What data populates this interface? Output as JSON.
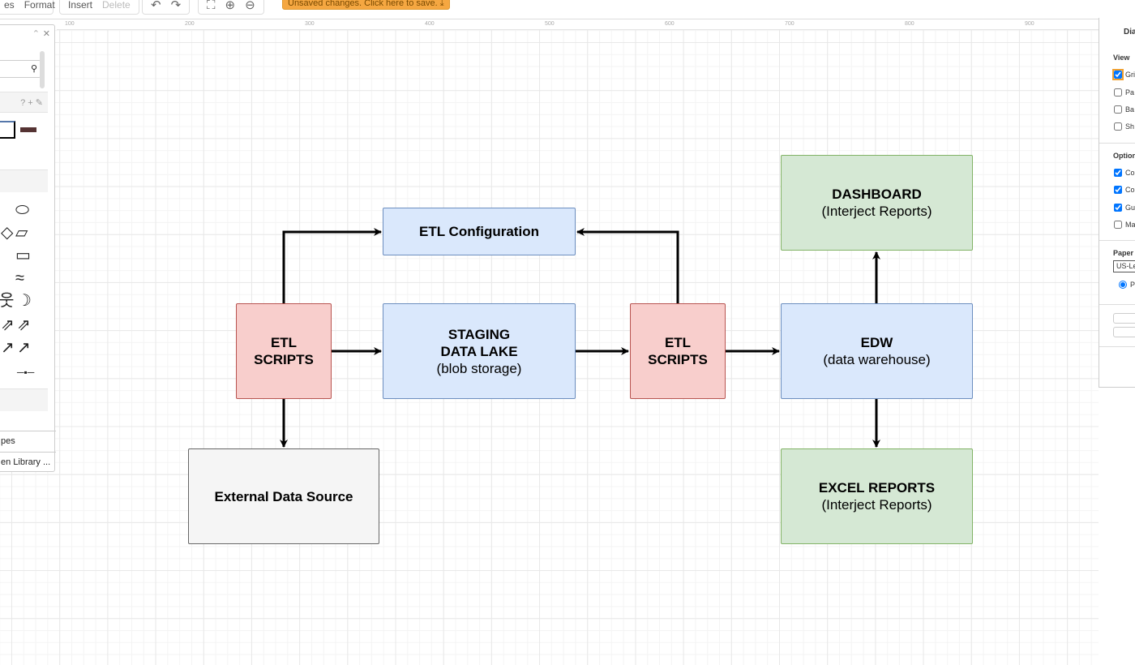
{
  "toolbar": {
    "tab_shapes": "es",
    "tab_format": "Format",
    "insert": "Insert",
    "delete": "Delete",
    "unsaved": "Unsaved changes. Click here to save."
  },
  "ruler": [
    "100",
    "200",
    "300",
    "400",
    "500",
    "600",
    "700",
    "800",
    "900"
  ],
  "left_panel": {
    "more_shapes": "pes",
    "open_library": "en Library ..."
  },
  "right_panel": {
    "title": "Dia",
    "view": "View",
    "view_items": [
      {
        "label": "Gri",
        "checked": true
      },
      {
        "label": "Pa",
        "checked": false
      },
      {
        "label": "Ba",
        "checked": false
      },
      {
        "label": "Sh",
        "checked": false
      }
    ],
    "options": "Option",
    "option_items": [
      {
        "label": "Co",
        "checked": true
      },
      {
        "label": "Co",
        "checked": true
      },
      {
        "label": "Gu",
        "checked": true
      },
      {
        "label": "Ma",
        "checked": false
      }
    ],
    "paper": "Paper",
    "paper_value": "US-Le",
    "orientation": "P"
  },
  "diagram": {
    "etl_config": "ETL Configuration",
    "etl_left": [
      "ETL",
      "SCRIPTS"
    ],
    "staging": [
      "STAGING",
      "DATA LAKE",
      "(blob storage)"
    ],
    "etl_right": [
      "ETL",
      "SCRIPTS"
    ],
    "edw": [
      "EDW",
      "(data warehouse)"
    ],
    "dashboard": [
      "DASHBOARD",
      "(Interject Reports)"
    ],
    "excel": [
      "EXCEL REPORTS",
      "(Interject Reports)"
    ],
    "external": "External Data Source",
    "colors": {
      "blue_fill": "#dae8fc",
      "blue_stroke": "#6c8ebf",
      "red_fill": "#f8cecc",
      "red_stroke": "#b85450",
      "green_fill": "#d5e8d4",
      "green_stroke": "#82b366",
      "gray_fill": "#f5f5f5",
      "gray_stroke": "#666666"
    }
  }
}
